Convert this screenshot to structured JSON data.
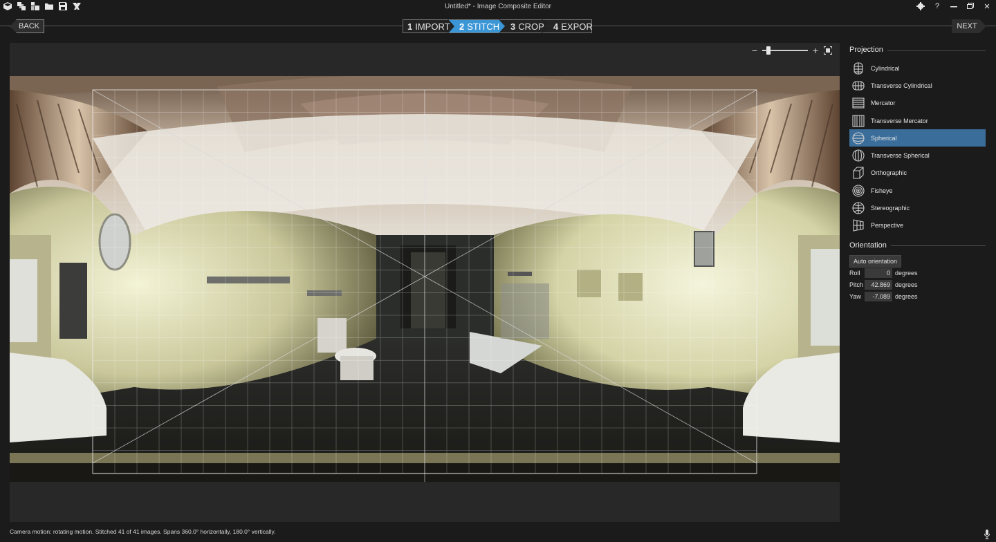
{
  "window": {
    "title": "Untitled* - Image Composite Editor"
  },
  "toolbar": {
    "icons": [
      "new-panorama-icon",
      "new-from-video-icon",
      "open-icon",
      "folder-icon",
      "save-icon",
      "publish-icon"
    ]
  },
  "window_controls": {
    "icons": [
      "settings-icon",
      "help-icon",
      "minimize-icon",
      "restore-icon",
      "close-icon"
    ],
    "help": "?",
    "close": "✕"
  },
  "wizard": {
    "back_label": "BACK",
    "next_label": "NEXT",
    "steps": [
      {
        "num": "1",
        "label": "IMPORT"
      },
      {
        "num": "2",
        "label": "STITCH"
      },
      {
        "num": "3",
        "label": "CROP"
      },
      {
        "num": "4",
        "label": "EXPORT"
      }
    ],
    "active_step": "2",
    "accent_color": "#3b96d6"
  },
  "zoom": {
    "minus": "−",
    "plus": "+",
    "level": 0.1
  },
  "projection": {
    "title": "Projection",
    "items": [
      {
        "label": "Cylindrical",
        "icon": "cylindrical-icon"
      },
      {
        "label": "Transverse Cylindrical",
        "icon": "transverse-cylindrical-icon"
      },
      {
        "label": "Mercator",
        "icon": "mercator-icon"
      },
      {
        "label": "Transverse Mercator",
        "icon": "transverse-mercator-icon"
      },
      {
        "label": "Spherical",
        "icon": "spherical-icon"
      },
      {
        "label": "Transverse Spherical",
        "icon": "transverse-spherical-icon"
      },
      {
        "label": "Orthographic",
        "icon": "orthographic-icon"
      },
      {
        "label": "Fisheye",
        "icon": "fisheye-icon"
      },
      {
        "label": "Stereographic",
        "icon": "stereographic-icon"
      },
      {
        "label": "Perspective",
        "icon": "perspective-icon"
      }
    ],
    "selected": "Spherical",
    "selected_color": "#3a6d9a"
  },
  "orientation": {
    "title": "Orientation",
    "auto_label": "Auto orientation",
    "roll_label": "Roll",
    "roll_value": "0",
    "pitch_label": "Pitch",
    "pitch_value": "42.869",
    "yaw_label": "Yaw",
    "yaw_value": "-7.089",
    "unit": "degrees"
  },
  "status": {
    "text": "Camera motion: rotating motion. Stitched 41 of 41 images. Spans 360.0° horizontally, 180.0° vertically."
  }
}
